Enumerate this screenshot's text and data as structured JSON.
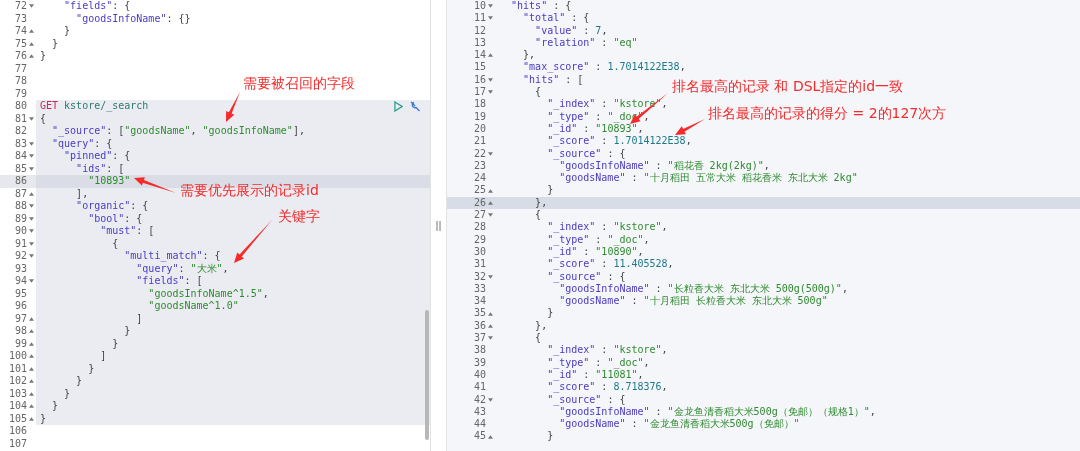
{
  "request_editor": {
    "lines": [
      {
        "n": "72",
        "kind": "start",
        "in_request": false,
        "current": false,
        "tokens": [
          {
            "kind": "key",
            "text": "    \"fields\""
          },
          {
            "kind": "punct",
            "text": ": {"
          }
        ]
      },
      {
        "n": "73",
        "kind": "plain",
        "in_request": false,
        "current": false,
        "tokens": [
          {
            "kind": "key",
            "text": "      \"goodsInfoName\""
          },
          {
            "kind": "punct",
            "text": ": {}"
          }
        ]
      },
      {
        "n": "74",
        "kind": "end",
        "in_request": false,
        "current": false,
        "tokens": [
          {
            "kind": "punct",
            "text": "    }"
          }
        ]
      },
      {
        "n": "75",
        "kind": "end",
        "in_request": false,
        "current": false,
        "tokens": [
          {
            "kind": "punct",
            "text": "  }"
          }
        ]
      },
      {
        "n": "76",
        "kind": "end",
        "in_request": false,
        "current": false,
        "tokens": [
          {
            "kind": "punct",
            "text": "}"
          }
        ]
      },
      {
        "n": "77",
        "kind": "plain",
        "in_request": false,
        "current": false
      },
      {
        "n": "78",
        "kind": "plain",
        "in_request": false,
        "current": false
      },
      {
        "n": "79",
        "kind": "plain",
        "in_request": false,
        "current": false
      },
      {
        "n": "80",
        "kind": "plain",
        "in_request": true,
        "current": false,
        "tokens": [
          {
            "kind": "method",
            "text": "GET"
          },
          {
            "kind": "url",
            "text": " kstore/_search"
          }
        ]
      },
      {
        "n": "81",
        "kind": "start",
        "in_request": true,
        "current": false,
        "tokens": [
          {
            "kind": "punct",
            "text": "{"
          }
        ]
      },
      {
        "n": "82",
        "kind": "plain",
        "in_request": true,
        "current": false,
        "tokens": [
          {
            "kind": "key",
            "text": "  \"_source\""
          },
          {
            "kind": "punct",
            "text": ": ["
          },
          {
            "kind": "string",
            "text": "\"goodsName\""
          },
          {
            "kind": "punct",
            "text": ", "
          },
          {
            "kind": "string",
            "text": "\"goodsInfoName\""
          },
          {
            "kind": "punct",
            "text": "],"
          }
        ]
      },
      {
        "n": "83",
        "kind": "start",
        "in_request": true,
        "current": false,
        "tokens": [
          {
            "kind": "key",
            "text": "  \"query\""
          },
          {
            "kind": "punct",
            "text": ": {"
          }
        ]
      },
      {
        "n": "84",
        "kind": "start",
        "in_request": true,
        "current": false,
        "tokens": [
          {
            "kind": "key",
            "text": "    \"pinned\""
          },
          {
            "kind": "punct",
            "text": ": {"
          }
        ]
      },
      {
        "n": "85",
        "kind": "start",
        "in_request": true,
        "current": false,
        "tokens": [
          {
            "kind": "key",
            "text": "      \"ids\""
          },
          {
            "kind": "punct",
            "text": ": ["
          }
        ]
      },
      {
        "n": "86",
        "kind": "plain",
        "in_request": true,
        "current": true,
        "tokens": [
          {
            "kind": "string",
            "text": "        \"10893\""
          }
        ]
      },
      {
        "n": "87",
        "kind": "end",
        "in_request": true,
        "current": false,
        "tokens": [
          {
            "kind": "punct",
            "text": "      ],"
          }
        ]
      },
      {
        "n": "88",
        "kind": "start",
        "in_request": true,
        "current": false,
        "tokens": [
          {
            "kind": "key",
            "text": "      \"organic\""
          },
          {
            "kind": "punct",
            "text": ": {"
          }
        ]
      },
      {
        "n": "89",
        "kind": "start",
        "in_request": true,
        "current": false,
        "tokens": [
          {
            "kind": "key",
            "text": "        \"bool\""
          },
          {
            "kind": "punct",
            "text": ": {"
          }
        ]
      },
      {
        "n": "90",
        "kind": "start",
        "in_request": true,
        "current": false,
        "tokens": [
          {
            "kind": "key",
            "text": "          \"must\""
          },
          {
            "kind": "punct",
            "text": ": ["
          }
        ]
      },
      {
        "n": "91",
        "kind": "start",
        "in_request": true,
        "current": false,
        "tokens": [
          {
            "kind": "punct",
            "text": "            {"
          }
        ]
      },
      {
        "n": "92",
        "kind": "start",
        "in_request": true,
        "current": false,
        "tokens": [
          {
            "kind": "key",
            "text": "              \"multi_match\""
          },
          {
            "kind": "punct",
            "text": ": {"
          }
        ]
      },
      {
        "n": "93",
        "kind": "plain",
        "in_request": true,
        "current": false,
        "tokens": [
          {
            "kind": "key",
            "text": "                \"query\""
          },
          {
            "kind": "punct",
            "text": ": "
          },
          {
            "kind": "string",
            "text": "\"大米\""
          },
          {
            "kind": "punct",
            "text": ","
          }
        ]
      },
      {
        "n": "94",
        "kind": "start",
        "in_request": true,
        "current": false,
        "tokens": [
          {
            "kind": "key",
            "text": "                \"fields\""
          },
          {
            "kind": "punct",
            "text": ": ["
          }
        ]
      },
      {
        "n": "95",
        "kind": "plain",
        "in_request": true,
        "current": false,
        "tokens": [
          {
            "kind": "string",
            "text": "                  \"goodsInfoName^1.5\""
          },
          {
            "kind": "punct",
            "text": ","
          }
        ]
      },
      {
        "n": "96",
        "kind": "plain",
        "in_request": true,
        "current": false,
        "tokens": [
          {
            "kind": "string",
            "text": "                  \"goodsName^1.0\""
          }
        ]
      },
      {
        "n": "97",
        "kind": "end",
        "in_request": true,
        "current": false,
        "tokens": [
          {
            "kind": "punct",
            "text": "                ]"
          }
        ]
      },
      {
        "n": "98",
        "kind": "end",
        "in_request": true,
        "current": false,
        "tokens": [
          {
            "kind": "punct",
            "text": "              }"
          }
        ]
      },
      {
        "n": "99",
        "kind": "end",
        "in_request": true,
        "current": false,
        "tokens": [
          {
            "kind": "punct",
            "text": "            }"
          }
        ]
      },
      {
        "n": "100",
        "kind": "end",
        "in_request": true,
        "current": false,
        "tokens": [
          {
            "kind": "punct",
            "text": "          ]"
          }
        ]
      },
      {
        "n": "101",
        "kind": "end",
        "in_request": true,
        "current": false,
        "tokens": [
          {
            "kind": "punct",
            "text": "        }"
          }
        ]
      },
      {
        "n": "102",
        "kind": "end",
        "in_request": true,
        "current": false,
        "tokens": [
          {
            "kind": "punct",
            "text": "      }"
          }
        ]
      },
      {
        "n": "103",
        "kind": "end",
        "in_request": true,
        "current": false,
        "tokens": [
          {
            "kind": "punct",
            "text": "    }"
          }
        ]
      },
      {
        "n": "104",
        "kind": "end",
        "in_request": true,
        "current": false,
        "tokens": [
          {
            "kind": "punct",
            "text": "  }"
          }
        ]
      },
      {
        "n": "105",
        "kind": "end",
        "in_request": true,
        "current": false,
        "tokens": [
          {
            "kind": "punct",
            "text": "}"
          }
        ]
      },
      {
        "n": "106",
        "kind": "plain",
        "in_request": false,
        "current": false
      },
      {
        "n": "107",
        "kind": "plain",
        "in_request": false,
        "current": false
      }
    ]
  },
  "response_viewer": {
    "lines": [
      {
        "n": "10",
        "kind": "start",
        "current": false,
        "tokens": [
          {
            "kind": "key",
            "text": "  \"hits\""
          },
          {
            "kind": "punct",
            "text": " : {"
          }
        ]
      },
      {
        "n": "11",
        "kind": "start",
        "current": false,
        "tokens": [
          {
            "kind": "key",
            "text": "    \"total\""
          },
          {
            "kind": "punct",
            "text": " : {"
          }
        ]
      },
      {
        "n": "12",
        "kind": "plain",
        "current": false,
        "tokens": [
          {
            "kind": "key",
            "text": "      \"value\""
          },
          {
            "kind": "punct",
            "text": " : "
          },
          {
            "kind": "number",
            "text": "7"
          },
          {
            "kind": "punct",
            "text": ","
          }
        ]
      },
      {
        "n": "13",
        "kind": "plain",
        "current": false,
        "tokens": [
          {
            "kind": "key",
            "text": "      \"relation\""
          },
          {
            "kind": "punct",
            "text": " : "
          },
          {
            "kind": "string",
            "text": "\"eq\""
          }
        ]
      },
      {
        "n": "14",
        "kind": "end",
        "current": false,
        "tokens": [
          {
            "kind": "punct",
            "text": "    },"
          }
        ]
      },
      {
        "n": "15",
        "kind": "plain",
        "current": false,
        "tokens": [
          {
            "kind": "key",
            "text": "    \"max_score\""
          },
          {
            "kind": "punct",
            "text": " : "
          },
          {
            "kind": "number",
            "text": "1.7014122E38"
          },
          {
            "kind": "punct",
            "text": ","
          }
        ]
      },
      {
        "n": "16",
        "kind": "start",
        "current": false,
        "tokens": [
          {
            "kind": "key",
            "text": "    \"hits\""
          },
          {
            "kind": "punct",
            "text": " : ["
          }
        ]
      },
      {
        "n": "17",
        "kind": "start",
        "current": false,
        "tokens": [
          {
            "kind": "punct",
            "text": "      {"
          }
        ]
      },
      {
        "n": "18",
        "kind": "plain",
        "current": false,
        "tokens": [
          {
            "kind": "key",
            "text": "        \"_index\""
          },
          {
            "kind": "punct",
            "text": " : "
          },
          {
            "kind": "string",
            "text": "\"kstore\""
          },
          {
            "kind": "punct",
            "text": ","
          }
        ]
      },
      {
        "n": "19",
        "kind": "plain",
        "current": false,
        "tokens": [
          {
            "kind": "key",
            "text": "        \"_type\""
          },
          {
            "kind": "punct",
            "text": " : "
          },
          {
            "kind": "string",
            "text": "\"_doc\""
          },
          {
            "kind": "punct",
            "text": ","
          }
        ]
      },
      {
        "n": "20",
        "kind": "plain",
        "current": false,
        "tokens": [
          {
            "kind": "key",
            "text": "        \"_id\""
          },
          {
            "kind": "punct",
            "text": " : "
          },
          {
            "kind": "string",
            "text": "\"10893\""
          },
          {
            "kind": "punct",
            "text": ","
          }
        ]
      },
      {
        "n": "21",
        "kind": "plain",
        "current": false,
        "tokens": [
          {
            "kind": "key",
            "text": "        \"_score\""
          },
          {
            "kind": "punct",
            "text": " : "
          },
          {
            "kind": "number",
            "text": "1.7014122E38"
          },
          {
            "kind": "punct",
            "text": ","
          }
        ]
      },
      {
        "n": "22",
        "kind": "start",
        "current": false,
        "tokens": [
          {
            "kind": "key",
            "text": "        \"_source\""
          },
          {
            "kind": "punct",
            "text": " : {"
          }
        ]
      },
      {
        "n": "23",
        "kind": "plain",
        "current": false,
        "tokens": [
          {
            "kind": "key",
            "text": "          \"goodsInfoName\""
          },
          {
            "kind": "punct",
            "text": " : "
          },
          {
            "kind": "string",
            "text": "\"稻花香 2kg(2kg)\""
          },
          {
            "kind": "punct",
            "text": ","
          }
        ]
      },
      {
        "n": "24",
        "kind": "plain",
        "current": false,
        "tokens": [
          {
            "kind": "key",
            "text": "          \"goodsName\""
          },
          {
            "kind": "punct",
            "text": " : "
          },
          {
            "kind": "string",
            "text": "\"十月稻田 五常大米 稻花香米 东北大米 2kg\""
          }
        ]
      },
      {
        "n": "25",
        "kind": "end",
        "current": false,
        "tokens": [
          {
            "kind": "punct",
            "text": "        }"
          }
        ]
      },
      {
        "n": "26",
        "kind": "end",
        "current": true,
        "tokens": [
          {
            "kind": "punct",
            "text": "      },"
          }
        ]
      },
      {
        "n": "27",
        "kind": "start",
        "current": false,
        "tokens": [
          {
            "kind": "punct",
            "text": "      {"
          }
        ]
      },
      {
        "n": "28",
        "kind": "plain",
        "current": false,
        "tokens": [
          {
            "kind": "key",
            "text": "        \"_index\""
          },
          {
            "kind": "punct",
            "text": " : "
          },
          {
            "kind": "string",
            "text": "\"kstore\""
          },
          {
            "kind": "punct",
            "text": ","
          }
        ]
      },
      {
        "n": "29",
        "kind": "plain",
        "current": false,
        "tokens": [
          {
            "kind": "key",
            "text": "        \"_type\""
          },
          {
            "kind": "punct",
            "text": " : "
          },
          {
            "kind": "string",
            "text": "\"_doc\""
          },
          {
            "kind": "punct",
            "text": ","
          }
        ]
      },
      {
        "n": "30",
        "kind": "plain",
        "current": false,
        "tokens": [
          {
            "kind": "key",
            "text": "        \"_id\""
          },
          {
            "kind": "punct",
            "text": " : "
          },
          {
            "kind": "string",
            "text": "\"10890\""
          },
          {
            "kind": "punct",
            "text": ","
          }
        ]
      },
      {
        "n": "31",
        "kind": "plain",
        "current": false,
        "tokens": [
          {
            "kind": "key",
            "text": "        \"_score\""
          },
          {
            "kind": "punct",
            "text": " : "
          },
          {
            "kind": "number",
            "text": "11.405528"
          },
          {
            "kind": "punct",
            "text": ","
          }
        ]
      },
      {
        "n": "32",
        "kind": "start",
        "current": false,
        "tokens": [
          {
            "kind": "key",
            "text": "        \"_source\""
          },
          {
            "kind": "punct",
            "text": " : {"
          }
        ]
      },
      {
        "n": "33",
        "kind": "plain",
        "current": false,
        "tokens": [
          {
            "kind": "key",
            "text": "          \"goodsInfoName\""
          },
          {
            "kind": "punct",
            "text": " : "
          },
          {
            "kind": "string",
            "text": "\"长粒香大米 东北大米 500g(500g)\""
          },
          {
            "kind": "punct",
            "text": ","
          }
        ]
      },
      {
        "n": "34",
        "kind": "plain",
        "current": false,
        "tokens": [
          {
            "kind": "key",
            "text": "          \"goodsName\""
          },
          {
            "kind": "punct",
            "text": " : "
          },
          {
            "kind": "string",
            "text": "\"十月稻田 长粒香大米 东北大米 500g\""
          }
        ]
      },
      {
        "n": "35",
        "kind": "end",
        "current": false,
        "tokens": [
          {
            "kind": "punct",
            "text": "        }"
          }
        ]
      },
      {
        "n": "36",
        "kind": "end",
        "current": false,
        "tokens": [
          {
            "kind": "punct",
            "text": "      },"
          }
        ]
      },
      {
        "n": "37",
        "kind": "start",
        "current": false,
        "tokens": [
          {
            "kind": "punct",
            "text": "      {"
          }
        ]
      },
      {
        "n": "38",
        "kind": "plain",
        "current": false,
        "tokens": [
          {
            "kind": "key",
            "text": "        \"_index\""
          },
          {
            "kind": "punct",
            "text": " : "
          },
          {
            "kind": "string",
            "text": "\"kstore\""
          },
          {
            "kind": "punct",
            "text": ","
          }
        ]
      },
      {
        "n": "39",
        "kind": "plain",
        "current": false,
        "tokens": [
          {
            "kind": "key",
            "text": "        \"_type\""
          },
          {
            "kind": "punct",
            "text": " : "
          },
          {
            "kind": "string",
            "text": "\"_doc\""
          },
          {
            "kind": "punct",
            "text": ","
          }
        ]
      },
      {
        "n": "40",
        "kind": "plain",
        "current": false,
        "tokens": [
          {
            "kind": "key",
            "text": "        \"_id\""
          },
          {
            "kind": "punct",
            "text": " : "
          },
          {
            "kind": "string",
            "text": "\"11081\""
          },
          {
            "kind": "punct",
            "text": ","
          }
        ]
      },
      {
        "n": "41",
        "kind": "plain",
        "current": false,
        "tokens": [
          {
            "kind": "key",
            "text": "        \"_score\""
          },
          {
            "kind": "punct",
            "text": " : "
          },
          {
            "kind": "number",
            "text": "8.718376"
          },
          {
            "kind": "punct",
            "text": ","
          }
        ]
      },
      {
        "n": "42",
        "kind": "start",
        "current": false,
        "tokens": [
          {
            "kind": "key",
            "text": "        \"_source\""
          },
          {
            "kind": "punct",
            "text": " : {"
          }
        ]
      },
      {
        "n": "43",
        "kind": "plain",
        "current": false,
        "tokens": [
          {
            "kind": "key",
            "text": "          \"goodsInfoName\""
          },
          {
            "kind": "punct",
            "text": " : "
          },
          {
            "kind": "string",
            "text": "\"金龙鱼清香稻大米500g（免邮）（规格1）\""
          },
          {
            "kind": "punct",
            "text": ","
          }
        ]
      },
      {
        "n": "44",
        "kind": "plain",
        "current": false,
        "tokens": [
          {
            "kind": "key",
            "text": "          \"goodsName\""
          },
          {
            "kind": "punct",
            "text": " : "
          },
          {
            "kind": "string",
            "text": "\"金龙鱼清香稻大米500g（免邮）\""
          }
        ]
      },
      {
        "n": "45",
        "kind": "end",
        "current": false,
        "tokens": [
          {
            "kind": "punct",
            "text": "        }"
          }
        ]
      }
    ]
  },
  "annotations": [
    {
      "text": "需要被召回的字段"
    },
    {
      "text": "需要优先展示的记录id"
    },
    {
      "text": "关键字"
    },
    {
      "text": "排名最高的记录 和 DSL指定的id一致"
    },
    {
      "text": "排名最高的记录的得分 = 2的127次方"
    }
  ]
}
